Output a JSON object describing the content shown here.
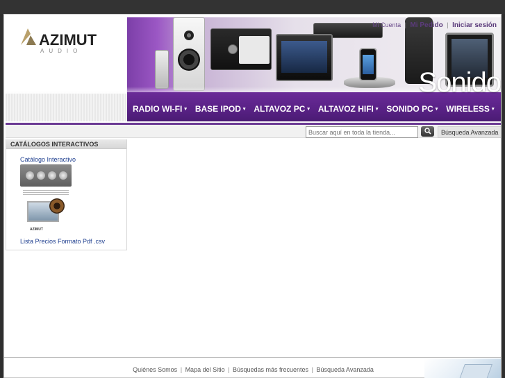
{
  "header": {
    "logo_text": "AZIMUT",
    "logo_sub": "AUDIO",
    "banner_word": "Sonido",
    "user_links": [
      "Mi Cuenta",
      "Mi Pedido",
      "Iniciar sesión"
    ],
    "user_links_separator": "|"
  },
  "nav": {
    "items": [
      {
        "label": "RADIO WI-FI"
      },
      {
        "label": "BASE IPOD"
      },
      {
        "label": "ALTAVOZ PC"
      },
      {
        "label": "ALTAVOZ HIFI"
      },
      {
        "label": "SONIDO PC"
      },
      {
        "label": "WIRELESS"
      }
    ],
    "caret": "▾"
  },
  "search": {
    "placeholder": "Buscar aquí en toda la tienda...",
    "advanced_label": "Búsqueda Avanzada"
  },
  "sidebar": {
    "title": "CATÁLOGOS INTERACTIVOS",
    "catalog_link": "Catálogo Interactivo",
    "price_list_link": "Lista Precios Formato Pdf .csv"
  },
  "footer": {
    "links": [
      "Quiénes Somos",
      "Mapa del Sitio",
      "Búsquedas más frecuentes",
      "Búsqueda Avanzada"
    ],
    "separator": "|"
  },
  "colors": {
    "accent_purple": "#6b3a94",
    "nav_band": "#5a2287",
    "link_blue": "#1f3f8f",
    "top_bar": "#333333"
  }
}
